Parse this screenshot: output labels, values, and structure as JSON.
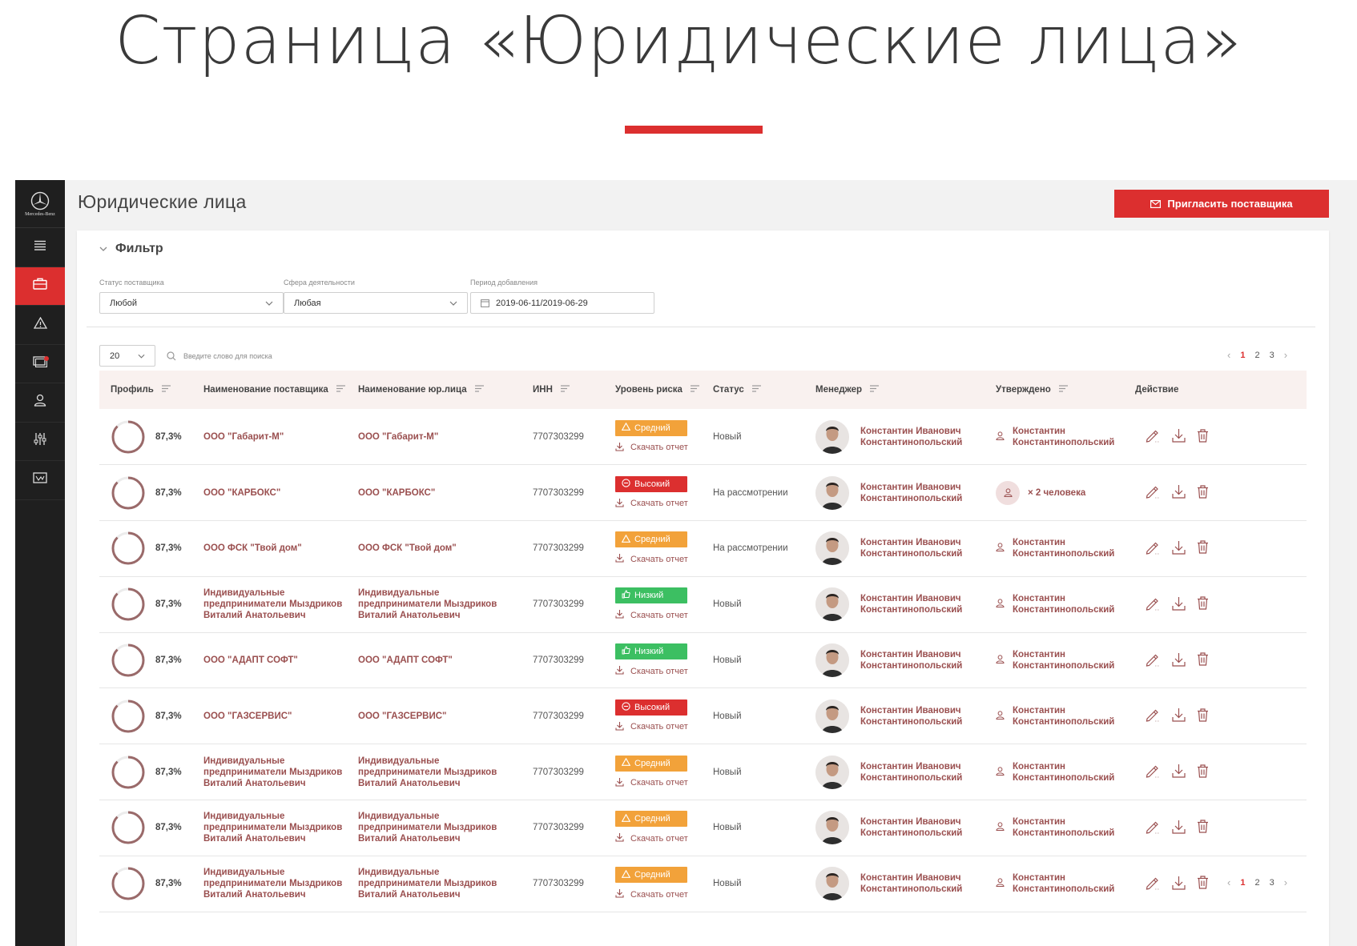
{
  "hero": {
    "title": "Страница «Юридические лица»"
  },
  "logo": {
    "brand": "Mercedes-Benz"
  },
  "colors": {
    "accent": "#dc2f2f",
    "risk_mid": "#f2a23a",
    "risk_high": "#dc2f2f",
    "risk_low": "#3cbf62",
    "link": "#9a4f4f"
  },
  "sidebar": {
    "items": [
      {
        "icon": "menu-icon",
        "active": false
      },
      {
        "icon": "briefcase-icon",
        "active": true
      },
      {
        "icon": "warning-icon",
        "active": false
      },
      {
        "icon": "messages-icon",
        "active": false,
        "notification": true
      },
      {
        "icon": "user-icon",
        "active": false
      },
      {
        "icon": "sliders-icon",
        "active": false
      },
      {
        "icon": "report-icon",
        "active": false
      }
    ]
  },
  "header": {
    "title": "Юридические лица",
    "invite_label": "Пригласить поставщика"
  },
  "filter": {
    "title": "Фильтр",
    "status": {
      "label": "Статус поставщика",
      "value": "Любой"
    },
    "sphere": {
      "label": "Сфера деятельности",
      "value": "Любая"
    },
    "period": {
      "label": "Период добавления",
      "value": "2019-06-11/2019-06-29"
    }
  },
  "toolbar": {
    "page_size": "20",
    "search_placeholder": "Введите слово для поиска"
  },
  "pagination": {
    "pages": [
      "1",
      "2",
      "3"
    ],
    "current": "1"
  },
  "table": {
    "columns": [
      "Профиль",
      "Наименование поставщика",
      "Наименование юр.лица",
      "ИНН",
      "Уровень риска",
      "Статус",
      "Менеджер",
      "Утверждено",
      "Действие"
    ],
    "download_label": "Скачать отчет",
    "rows": [
      {
        "profile": "87,3%",
        "supplier": "ООО \"Габарит-М\"",
        "legal": "ООО \"Габарит-М\"",
        "inn": "7707303299",
        "risk": "Средний",
        "risk_level": "mid",
        "status": "Новый",
        "manager": "Константин Иванович Константинопольский",
        "approved": "Константин Константинопольский",
        "approved_type": "person"
      },
      {
        "profile": "87,3%",
        "supplier": "ООО \"КАРБОКС\"",
        "legal": "ООО \"КАРБОКС\"",
        "inn": "7707303299",
        "risk": "Высокий",
        "risk_level": "high",
        "status": "На рассмотрении",
        "manager": "Константин Иванович Константинопольский",
        "approved": "× 2 человека",
        "approved_type": "group"
      },
      {
        "profile": "87,3%",
        "supplier": "ООО ФСК \"Твой дом\"",
        "legal": "ООО ФСК \"Твой дом\"",
        "inn": "7707303299",
        "risk": "Средний",
        "risk_level": "mid",
        "status": "На рассмотрении",
        "manager": "Константин Иванович Константинопольский",
        "approved": "Константин Константинопольский",
        "approved_type": "person"
      },
      {
        "profile": "87,3%",
        "supplier": "Индивидуальные предприниматели Мыздриков Виталий Анатольевич",
        "legal": "Индивидуальные предприниматели Мыздриков Виталий Анатольевич",
        "inn": "7707303299",
        "risk": "Низкий",
        "risk_level": "low",
        "status": "Новый",
        "manager": "Константин Иванович Константинопольский",
        "approved": "Константин Константинопольский",
        "approved_type": "person"
      },
      {
        "profile": "87,3%",
        "supplier": "ООО \"АДАПТ СОФТ\"",
        "legal": "ООО \"АДАПТ СОФТ\"",
        "inn": "7707303299",
        "risk": "Низкий",
        "risk_level": "low",
        "status": "Новый",
        "manager": "Константин Иванович Константинопольский",
        "approved": "Константин Константинопольский",
        "approved_type": "person"
      },
      {
        "profile": "87,3%",
        "supplier": "ООО \"ГАЗСЕРВИС\"",
        "legal": "ООО \"ГАЗСЕРВИС\"",
        "inn": "7707303299",
        "risk": "Высокий",
        "risk_level": "high",
        "status": "Новый",
        "manager": "Константин Иванович Константинопольский",
        "approved": "Константин Константинопольский",
        "approved_type": "person"
      },
      {
        "profile": "87,3%",
        "supplier": "Индивидуальные предприниматели Мыздриков Виталий Анатольевич",
        "legal": "Индивидуальные предприниматели Мыздриков Виталий Анатольевич",
        "inn": "7707303299",
        "risk": "Средний",
        "risk_level": "mid",
        "status": "Новый",
        "manager": "Константин Иванович Константинопольский",
        "approved": "Константин Константинопольский",
        "approved_type": "person"
      },
      {
        "profile": "87,3%",
        "supplier": "Индивидуальные предприниматели Мыздриков Виталий Анатольевич",
        "legal": "Индивидуальные предприниматели Мыздриков Виталий Анатольевич",
        "inn": "7707303299",
        "risk": "Средний",
        "risk_level": "mid",
        "status": "Новый",
        "manager": "Константин Иванович Константинопольский",
        "approved": "Константин Константинопольский",
        "approved_type": "person"
      },
      {
        "profile": "87,3%",
        "supplier": "Индивидуальные предприниматели Мыздриков Виталий Анатольевич",
        "legal": "Индивидуальные предприниматели Мыздриков Виталий Анатольевич",
        "inn": "7707303299",
        "risk": "Средний",
        "risk_level": "mid",
        "status": "Новый",
        "manager": "Константин Иванович Константинопольский",
        "approved": "Константин Константинопольский",
        "approved_type": "person"
      }
    ]
  }
}
